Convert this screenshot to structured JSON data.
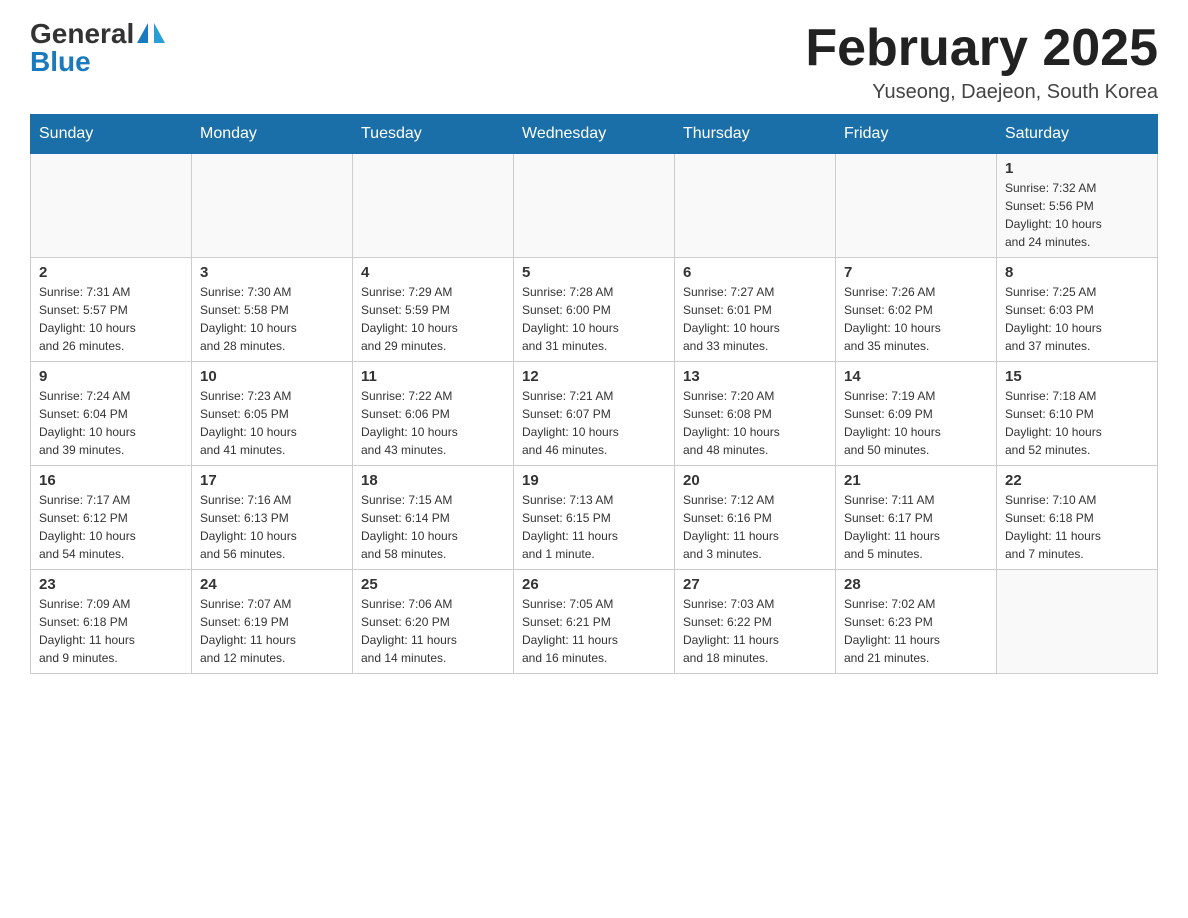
{
  "header": {
    "logo_general": "General",
    "logo_blue": "Blue",
    "month_title": "February 2025",
    "location": "Yuseong, Daejeon, South Korea"
  },
  "weekdays": [
    "Sunday",
    "Monday",
    "Tuesday",
    "Wednesday",
    "Thursday",
    "Friday",
    "Saturday"
  ],
  "weeks": [
    [
      {
        "day": "",
        "info": ""
      },
      {
        "day": "",
        "info": ""
      },
      {
        "day": "",
        "info": ""
      },
      {
        "day": "",
        "info": ""
      },
      {
        "day": "",
        "info": ""
      },
      {
        "day": "",
        "info": ""
      },
      {
        "day": "1",
        "info": "Sunrise: 7:32 AM\nSunset: 5:56 PM\nDaylight: 10 hours\nand 24 minutes."
      }
    ],
    [
      {
        "day": "2",
        "info": "Sunrise: 7:31 AM\nSunset: 5:57 PM\nDaylight: 10 hours\nand 26 minutes."
      },
      {
        "day": "3",
        "info": "Sunrise: 7:30 AM\nSunset: 5:58 PM\nDaylight: 10 hours\nand 28 minutes."
      },
      {
        "day": "4",
        "info": "Sunrise: 7:29 AM\nSunset: 5:59 PM\nDaylight: 10 hours\nand 29 minutes."
      },
      {
        "day": "5",
        "info": "Sunrise: 7:28 AM\nSunset: 6:00 PM\nDaylight: 10 hours\nand 31 minutes."
      },
      {
        "day": "6",
        "info": "Sunrise: 7:27 AM\nSunset: 6:01 PM\nDaylight: 10 hours\nand 33 minutes."
      },
      {
        "day": "7",
        "info": "Sunrise: 7:26 AM\nSunset: 6:02 PM\nDaylight: 10 hours\nand 35 minutes."
      },
      {
        "day": "8",
        "info": "Sunrise: 7:25 AM\nSunset: 6:03 PM\nDaylight: 10 hours\nand 37 minutes."
      }
    ],
    [
      {
        "day": "9",
        "info": "Sunrise: 7:24 AM\nSunset: 6:04 PM\nDaylight: 10 hours\nand 39 minutes."
      },
      {
        "day": "10",
        "info": "Sunrise: 7:23 AM\nSunset: 6:05 PM\nDaylight: 10 hours\nand 41 minutes."
      },
      {
        "day": "11",
        "info": "Sunrise: 7:22 AM\nSunset: 6:06 PM\nDaylight: 10 hours\nand 43 minutes."
      },
      {
        "day": "12",
        "info": "Sunrise: 7:21 AM\nSunset: 6:07 PM\nDaylight: 10 hours\nand 46 minutes."
      },
      {
        "day": "13",
        "info": "Sunrise: 7:20 AM\nSunset: 6:08 PM\nDaylight: 10 hours\nand 48 minutes."
      },
      {
        "day": "14",
        "info": "Sunrise: 7:19 AM\nSunset: 6:09 PM\nDaylight: 10 hours\nand 50 minutes."
      },
      {
        "day": "15",
        "info": "Sunrise: 7:18 AM\nSunset: 6:10 PM\nDaylight: 10 hours\nand 52 minutes."
      }
    ],
    [
      {
        "day": "16",
        "info": "Sunrise: 7:17 AM\nSunset: 6:12 PM\nDaylight: 10 hours\nand 54 minutes."
      },
      {
        "day": "17",
        "info": "Sunrise: 7:16 AM\nSunset: 6:13 PM\nDaylight: 10 hours\nand 56 minutes."
      },
      {
        "day": "18",
        "info": "Sunrise: 7:15 AM\nSunset: 6:14 PM\nDaylight: 10 hours\nand 58 minutes."
      },
      {
        "day": "19",
        "info": "Sunrise: 7:13 AM\nSunset: 6:15 PM\nDaylight: 11 hours\nand 1 minute."
      },
      {
        "day": "20",
        "info": "Sunrise: 7:12 AM\nSunset: 6:16 PM\nDaylight: 11 hours\nand 3 minutes."
      },
      {
        "day": "21",
        "info": "Sunrise: 7:11 AM\nSunset: 6:17 PM\nDaylight: 11 hours\nand 5 minutes."
      },
      {
        "day": "22",
        "info": "Sunrise: 7:10 AM\nSunset: 6:18 PM\nDaylight: 11 hours\nand 7 minutes."
      }
    ],
    [
      {
        "day": "23",
        "info": "Sunrise: 7:09 AM\nSunset: 6:18 PM\nDaylight: 11 hours\nand 9 minutes."
      },
      {
        "day": "24",
        "info": "Sunrise: 7:07 AM\nSunset: 6:19 PM\nDaylight: 11 hours\nand 12 minutes."
      },
      {
        "day": "25",
        "info": "Sunrise: 7:06 AM\nSunset: 6:20 PM\nDaylight: 11 hours\nand 14 minutes."
      },
      {
        "day": "26",
        "info": "Sunrise: 7:05 AM\nSunset: 6:21 PM\nDaylight: 11 hours\nand 16 minutes."
      },
      {
        "day": "27",
        "info": "Sunrise: 7:03 AM\nSunset: 6:22 PM\nDaylight: 11 hours\nand 18 minutes."
      },
      {
        "day": "28",
        "info": "Sunrise: 7:02 AM\nSunset: 6:23 PM\nDaylight: 11 hours\nand 21 minutes."
      },
      {
        "day": "",
        "info": ""
      }
    ]
  ]
}
